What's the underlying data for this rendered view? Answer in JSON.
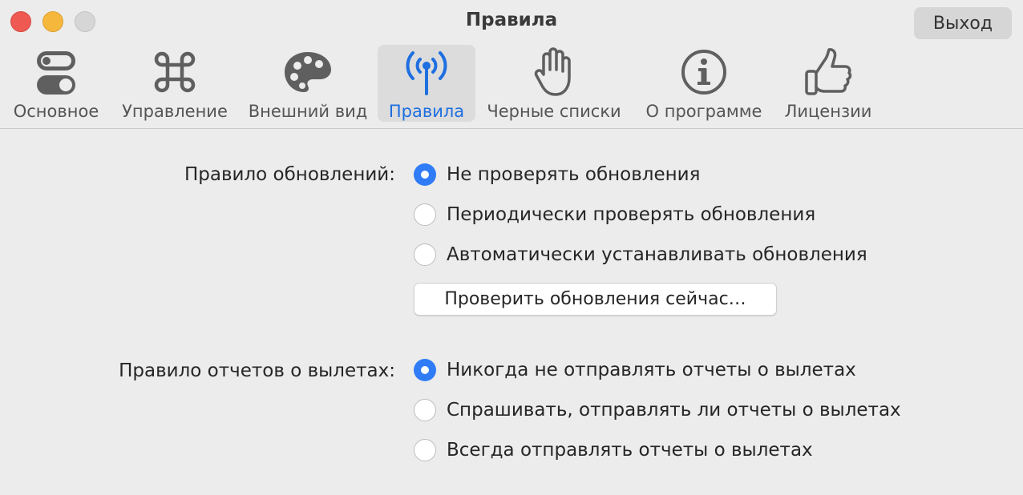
{
  "window": {
    "title": "Правила"
  },
  "header": {
    "exit_label": "Выход"
  },
  "tabs": [
    {
      "label": "Основное",
      "icon": "toggles-icon"
    },
    {
      "label": "Управление",
      "icon": "command-icon"
    },
    {
      "label": "Внешний вид",
      "icon": "palette-icon"
    },
    {
      "label": "Правила",
      "icon": "antenna-icon",
      "active": true
    },
    {
      "label": "Черные списки",
      "icon": "hand-icon"
    },
    {
      "label": "О программе",
      "icon": "info-icon"
    },
    {
      "label": "Лицензии",
      "icon": "thumbs-up-icon"
    }
  ],
  "updates": {
    "label": "Правило обновлений:",
    "options": [
      {
        "text": "Не проверять обновления",
        "selected": true
      },
      {
        "text": "Периодически проверять обновления",
        "selected": false
      },
      {
        "text": "Автоматически устанавливать обновления",
        "selected": false
      }
    ],
    "check_now": "Проверить обновления сейчас…"
  },
  "crash_reports": {
    "label": "Правило отчетов о вылетах:",
    "options": [
      {
        "text": "Никогда не отправлять отчеты о вылетах",
        "selected": true
      },
      {
        "text": "Спрашивать, отправлять ли отчеты о вылетах",
        "selected": false
      },
      {
        "text": "Всегда отправлять отчеты о вылетах",
        "selected": false
      }
    ]
  },
  "colors": {
    "accent": "#2f7cf6",
    "active_tab_text": "#1e6fe0",
    "icon": "#5f5f5f"
  }
}
